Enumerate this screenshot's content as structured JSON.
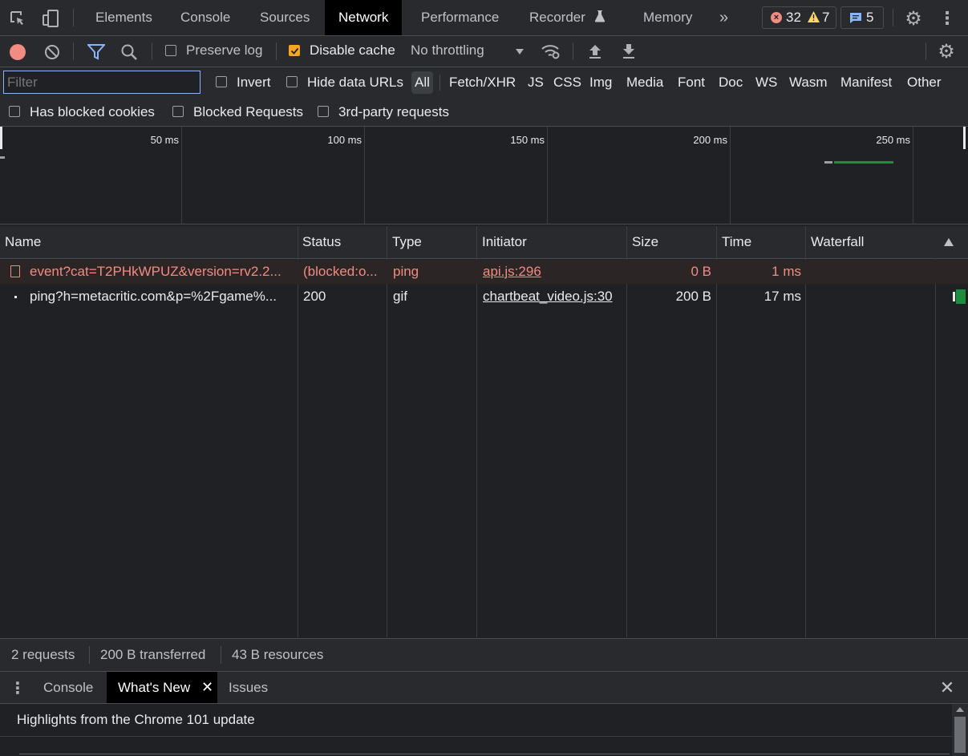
{
  "top_tabs": {
    "elements": "Elements",
    "console": "Console",
    "sources": "Sources",
    "network": "Network",
    "performance": "Performance",
    "recorder": "Recorder",
    "memory": "Memory"
  },
  "counters": {
    "errors": "32",
    "warnings": "7",
    "messages": "5"
  },
  "toolbar": {
    "preserve_log": "Preserve log",
    "disable_cache": "Disable cache",
    "throttling": "No throttling"
  },
  "filter_bar": {
    "placeholder": "Filter",
    "invert": "Invert",
    "hide_data_urls": "Hide data URLs",
    "types": [
      "All",
      "Fetch/XHR",
      "JS",
      "CSS",
      "Img",
      "Media",
      "Font",
      "Doc",
      "WS",
      "Wasm",
      "Manifest",
      "Other"
    ]
  },
  "filter_bar2": {
    "has_blocked_cookies": "Has blocked cookies",
    "blocked_requests": "Blocked Requests",
    "third_party": "3rd-party requests"
  },
  "timeline": {
    "ticks": [
      "50 ms",
      "100 ms",
      "150 ms",
      "200 ms",
      "250 ms"
    ]
  },
  "table": {
    "headers": {
      "name": "Name",
      "status": "Status",
      "type": "Type",
      "initiator": "Initiator",
      "size": "Size",
      "time": "Time",
      "waterfall": "Waterfall"
    },
    "rows": [
      {
        "name": "event?cat=T2PHkWPUZ&version=rv2.2...",
        "status": "(blocked:o...",
        "type": "ping",
        "initiator": "api.js:296",
        "size": "0 B",
        "time": "1 ms",
        "error": true
      },
      {
        "name": "ping?h=metacritic.com&p=%2Fgame%...",
        "status": "200",
        "type": "gif",
        "initiator": "chartbeat_video.js:30",
        "size": "200 B",
        "time": "17 ms",
        "error": false
      }
    ]
  },
  "summary": {
    "requests": "2 requests",
    "transferred": "200 B transferred",
    "resources": "43 B resources"
  },
  "drawer": {
    "tabs": {
      "console": "Console",
      "whats_new": "What's New",
      "issues": "Issues"
    },
    "content": "Highlights from the Chrome 101 update"
  },
  "colors": {
    "accent": "#8ab4f8",
    "error": "#f28b82",
    "checkbox_on": "#f5a623",
    "waterfall_green": "#1e8e3e"
  }
}
